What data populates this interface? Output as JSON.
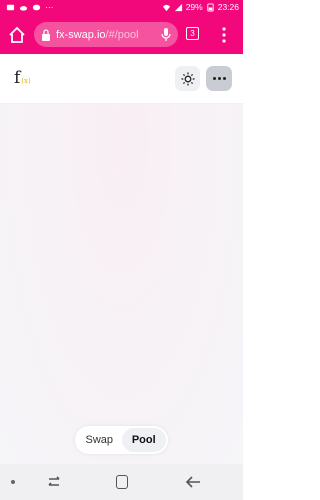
{
  "status_bar": {
    "notification_dots": "···",
    "battery": "29%",
    "time": "23:26"
  },
  "browser": {
    "url_domain": "fx-swap.io",
    "url_path": "/#/pool",
    "tab_count": "3"
  },
  "header": {
    "logo_letter": "f",
    "logo_subscript": "(x)"
  },
  "toggle": {
    "swap_label": "Swap",
    "pool_label": "Pool",
    "active": "Pool"
  },
  "colors": {
    "brand": "#f2087a",
    "accent": "#e4b400"
  },
  "icons": {
    "home": "home-icon",
    "lock": "lock-icon",
    "mic": "microphone-icon",
    "menu": "kebab-menu-icon",
    "theme": "sun-icon",
    "more": "more-icon"
  }
}
